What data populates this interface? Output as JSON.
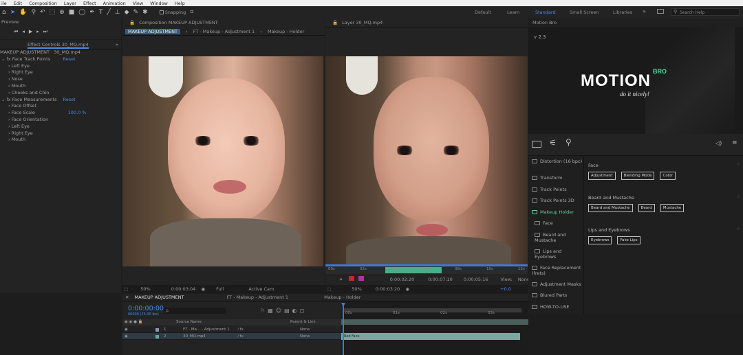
{
  "menu": [
    "ile",
    "Edit",
    "Composition",
    "Layer",
    "Effect",
    "Animation",
    "View",
    "Window",
    "Help"
  ],
  "toolbar": {
    "snapping": "Snapping",
    "workspaces": [
      "Default",
      "Learn",
      "Standard",
      "Small Screen",
      "Libraries"
    ],
    "search_placeholder": "Search Help"
  },
  "preview": {
    "title": "Preview"
  },
  "effect_controls": {
    "tab": "Effect Controls 30_MQ.mp4",
    "layer": "MAKEUP ADJUSTMENT · 30_MQ.mp4",
    "rows": [
      {
        "label": "fx Face Track Points",
        "value": "Reset"
      },
      {
        "label": "Left Eye"
      },
      {
        "label": "Right Eye"
      },
      {
        "label": "Nose"
      },
      {
        "label": "Mouth"
      },
      {
        "label": "Cheeks and Chin"
      },
      {
        "label": "fx Face Measurements",
        "value": "Reset"
      },
      {
        "label": "Face Offset"
      },
      {
        "label": "Face Scale",
        "value": "100.0 %"
      },
      {
        "label": "Face Orientation"
      },
      {
        "label": "Left Eye"
      },
      {
        "label": "Right Eye"
      },
      {
        "label": "Mouth"
      }
    ]
  },
  "composition": {
    "tab": "Composition MAKEUP ADJUSTMENT",
    "crumbs": [
      "MAKEUP ADJUSTMENT",
      "FT - Makeup - Adjustment 1",
      "Makeup - Holder"
    ],
    "footer": {
      "zoom": "50%",
      "time": "0:00:03:04",
      "quality": "Full",
      "view": "Active Cam"
    }
  },
  "layer": {
    "tab": "Layer 30_MQ.mp4",
    "ruler": [
      "00s",
      "02s",
      "04s",
      "06s",
      "08s",
      "10s",
      "12s"
    ],
    "times": [
      "0:00:02:20",
      "0:00:07:10",
      "0:00:05:16"
    ],
    "view_label": "View:",
    "view_value": "None",
    "footer": {
      "zoom": "50%",
      "time": "0:00:03:20",
      "offset": "+0.0"
    }
  },
  "motion_bro": {
    "title": "Motion Bro",
    "version": "v 2.3",
    "logo": "MOTION",
    "logo_badge": "BRO",
    "tagline": "do it nicely!",
    "categories": [
      {
        "label": "Distortion (16 bpc)",
        "indent": false,
        "active": false
      },
      {
        "label": "Transform",
        "indent": false,
        "active": false
      },
      {
        "label": "Track Points",
        "indent": false,
        "active": false
      },
      {
        "label": "Track Points 3D",
        "indent": false,
        "active": false
      },
      {
        "label": "Makeup Holder",
        "indent": false,
        "active": true
      },
      {
        "label": "Face",
        "indent": true,
        "active": false
      },
      {
        "label": "Beard and Mustache",
        "indent": true,
        "active": false
      },
      {
        "label": "Lips and Eyebrows",
        "indent": true,
        "active": false
      },
      {
        "label": "Face Replacement (frets)",
        "indent": false,
        "active": false
      },
      {
        "label": "Adjustment Masks",
        "indent": false,
        "active": false
      },
      {
        "label": "Blured Parts",
        "indent": false,
        "active": false
      },
      {
        "label": "HOW-TO-USE",
        "indent": false,
        "active": false
      }
    ],
    "groups": [
      {
        "title": "Face",
        "buttons": [
          "Adjustment",
          "Blending Mode",
          "Color"
        ]
      },
      {
        "title": "Beard and Mustache",
        "buttons": [
          "Beard and Mustache",
          "Beard",
          "Mustache"
        ]
      },
      {
        "title": "Lips and Eyebrows",
        "buttons": [
          "Eyebrows",
          "Fake Lips"
        ]
      }
    ]
  },
  "timeline": {
    "tabs": [
      "MAKEUP ADJUSTMENT",
      "FT - Makeup - Adjustment 1",
      "Makeup - Holder"
    ],
    "timecode": "0:00:00:00",
    "fps": "00000 (25.00 fps)",
    "search_placeholder": "ρ.",
    "col_source": "Source Name",
    "col_parent": "Parent & Link",
    "ruler": [
      "00s",
      "01s",
      "02s",
      "03s"
    ],
    "layers": [
      {
        "num": "1",
        "name": "FT - Ma... - Adjustment 1",
        "parent": "None"
      },
      {
        "num": "2",
        "name": "30_MQ.mp4",
        "parent": "None"
      }
    ],
    "clip_label": "Red Face"
  }
}
